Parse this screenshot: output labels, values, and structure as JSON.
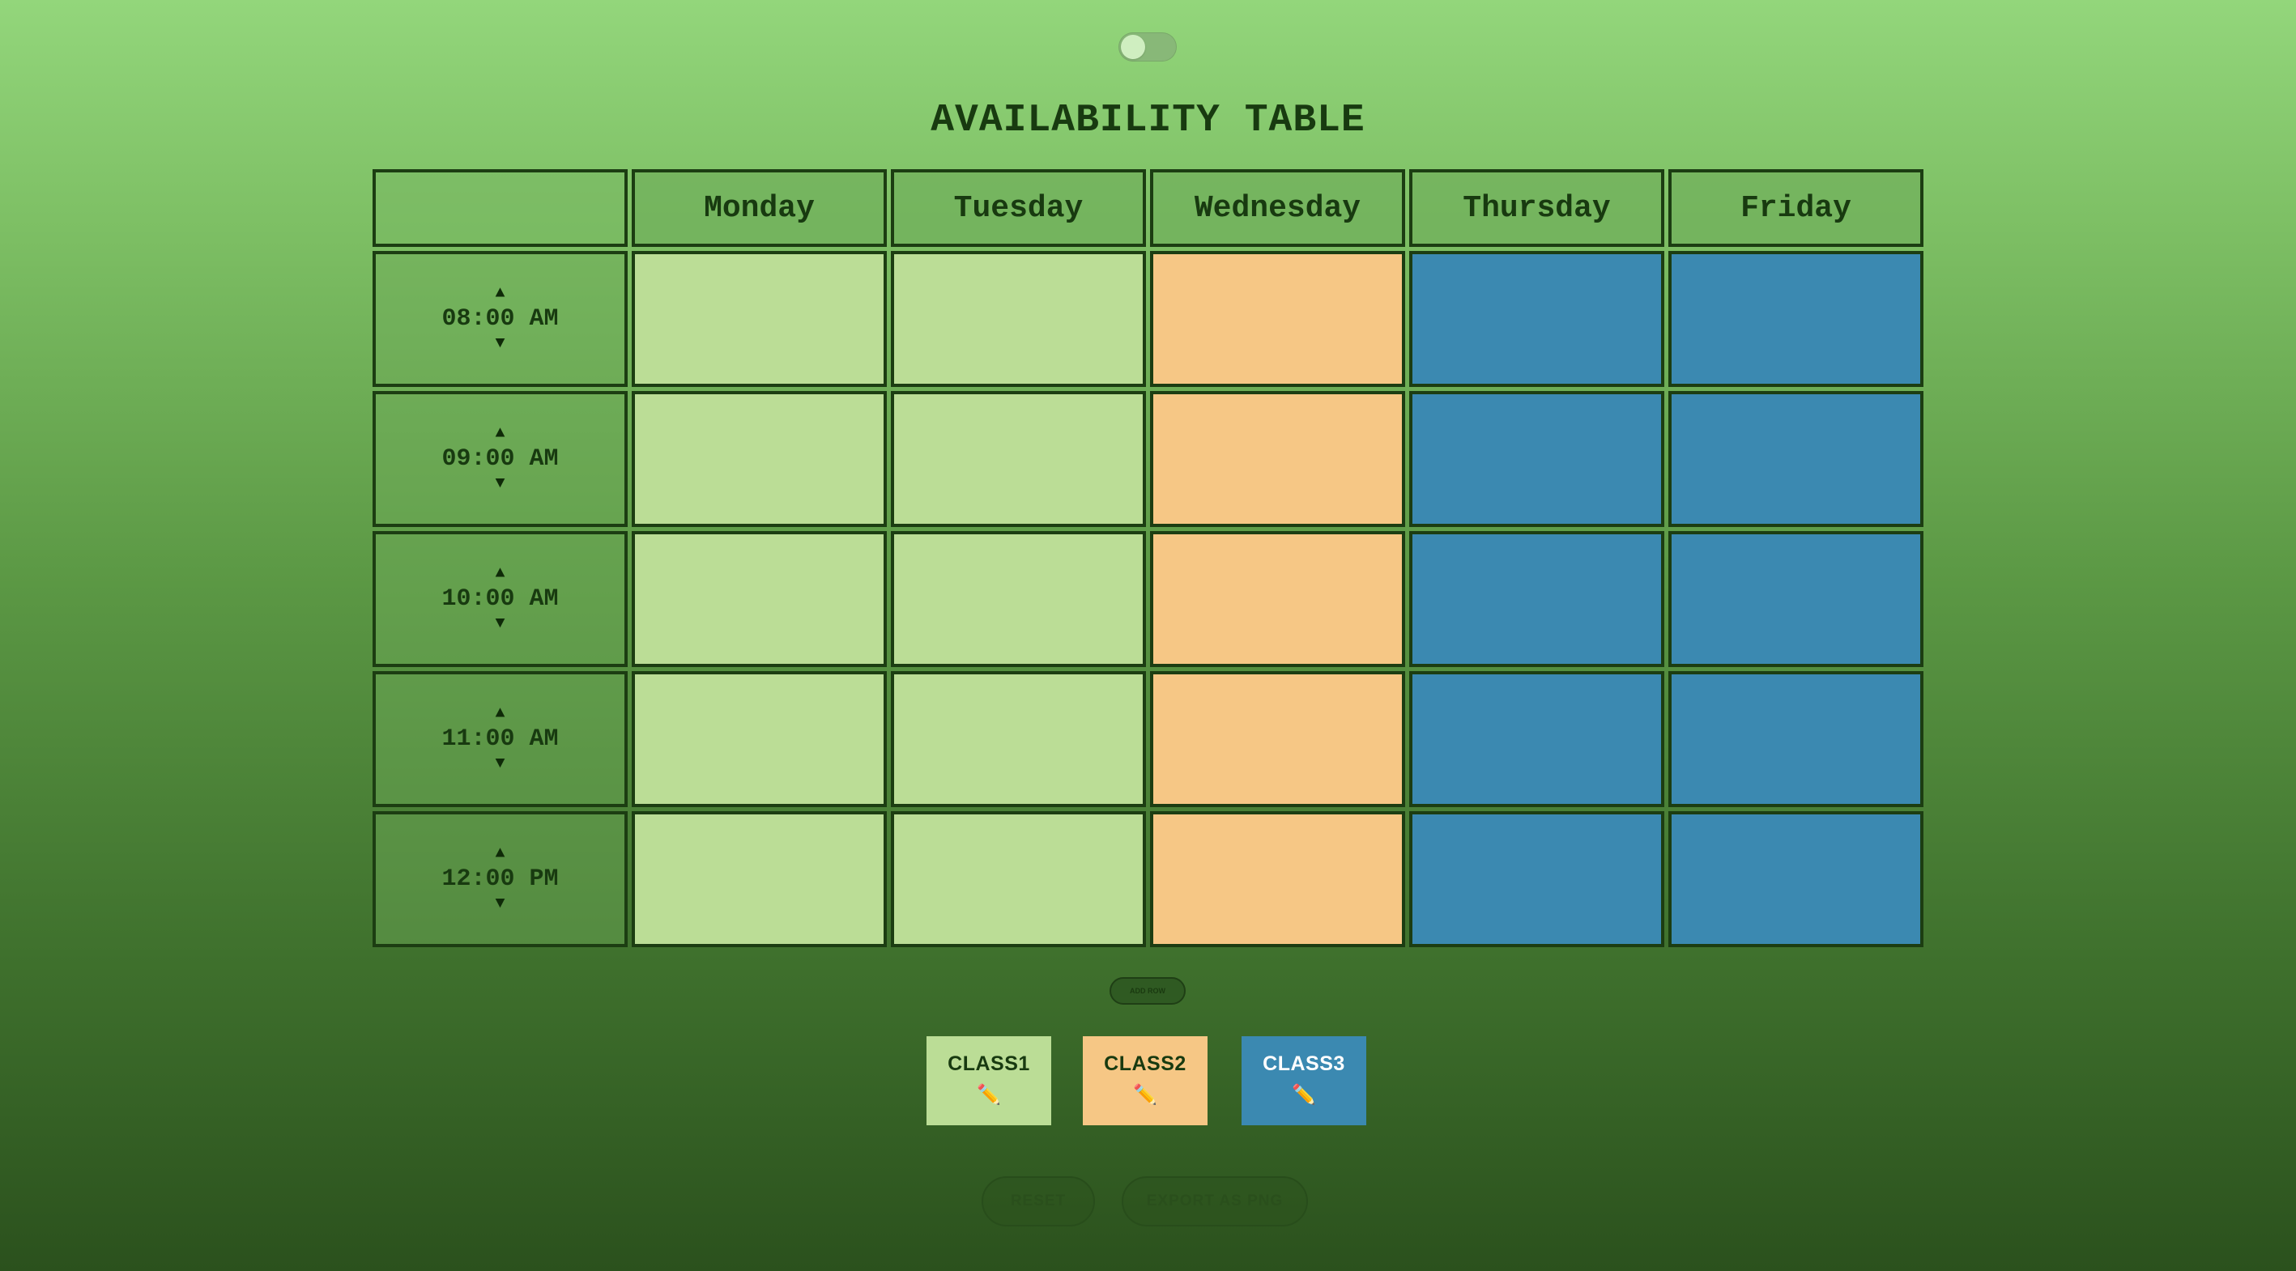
{
  "title": "AVAILABILITY TABLE",
  "header": {
    "corner": "",
    "days": [
      "Monday",
      "Tuesday",
      "Wednesday",
      "Thursday",
      "Friday"
    ]
  },
  "rows": [
    {
      "time": "08:00 AM",
      "up_arrow": "▲",
      "down_arrow": "▼",
      "slots": [
        "class1",
        "class1",
        "class2",
        "class3",
        "class3"
      ]
    },
    {
      "time": "09:00 AM",
      "up_arrow": "▲",
      "down_arrow": "▼",
      "slots": [
        "class1",
        "class1",
        "class2",
        "class3",
        "class3"
      ]
    },
    {
      "time": "10:00 AM",
      "up_arrow": "▲",
      "down_arrow": "▼",
      "slots": [
        "class1",
        "class1",
        "class2",
        "class3",
        "class3"
      ]
    },
    {
      "time": "11:00 AM",
      "up_arrow": "▲",
      "down_arrow": "▼",
      "slots": [
        "class1",
        "class1",
        "class2",
        "class3",
        "class3"
      ]
    },
    {
      "time": "12:00 PM",
      "up_arrow": "▲",
      "down_arrow": "▼",
      "slots": [
        "class1",
        "class1",
        "class2",
        "class3",
        "class3"
      ]
    }
  ],
  "classes": {
    "class1": {
      "label": "CLASS1",
      "color": "#bbdd96",
      "text_color": "#183a10",
      "edit_icon": "pencil-icon",
      "edit_glyph": "✏️"
    },
    "class2": {
      "label": "CLASS2",
      "color": "#f6c785",
      "text_color": "#183a10",
      "edit_icon": "pencil-icon",
      "edit_glyph": "✏️"
    },
    "class3": {
      "label": "CLASS3",
      "color": "#3b89b1",
      "text_color": "#ffffff",
      "edit_icon": "pencil-icon",
      "edit_glyph": "✏️"
    }
  },
  "buttons": {
    "add_row": "ADD ROW",
    "reset": "RESET",
    "export": "EXPORT AS PNG"
  },
  "toggle": {
    "icon": "theme-toggle",
    "on": false
  }
}
